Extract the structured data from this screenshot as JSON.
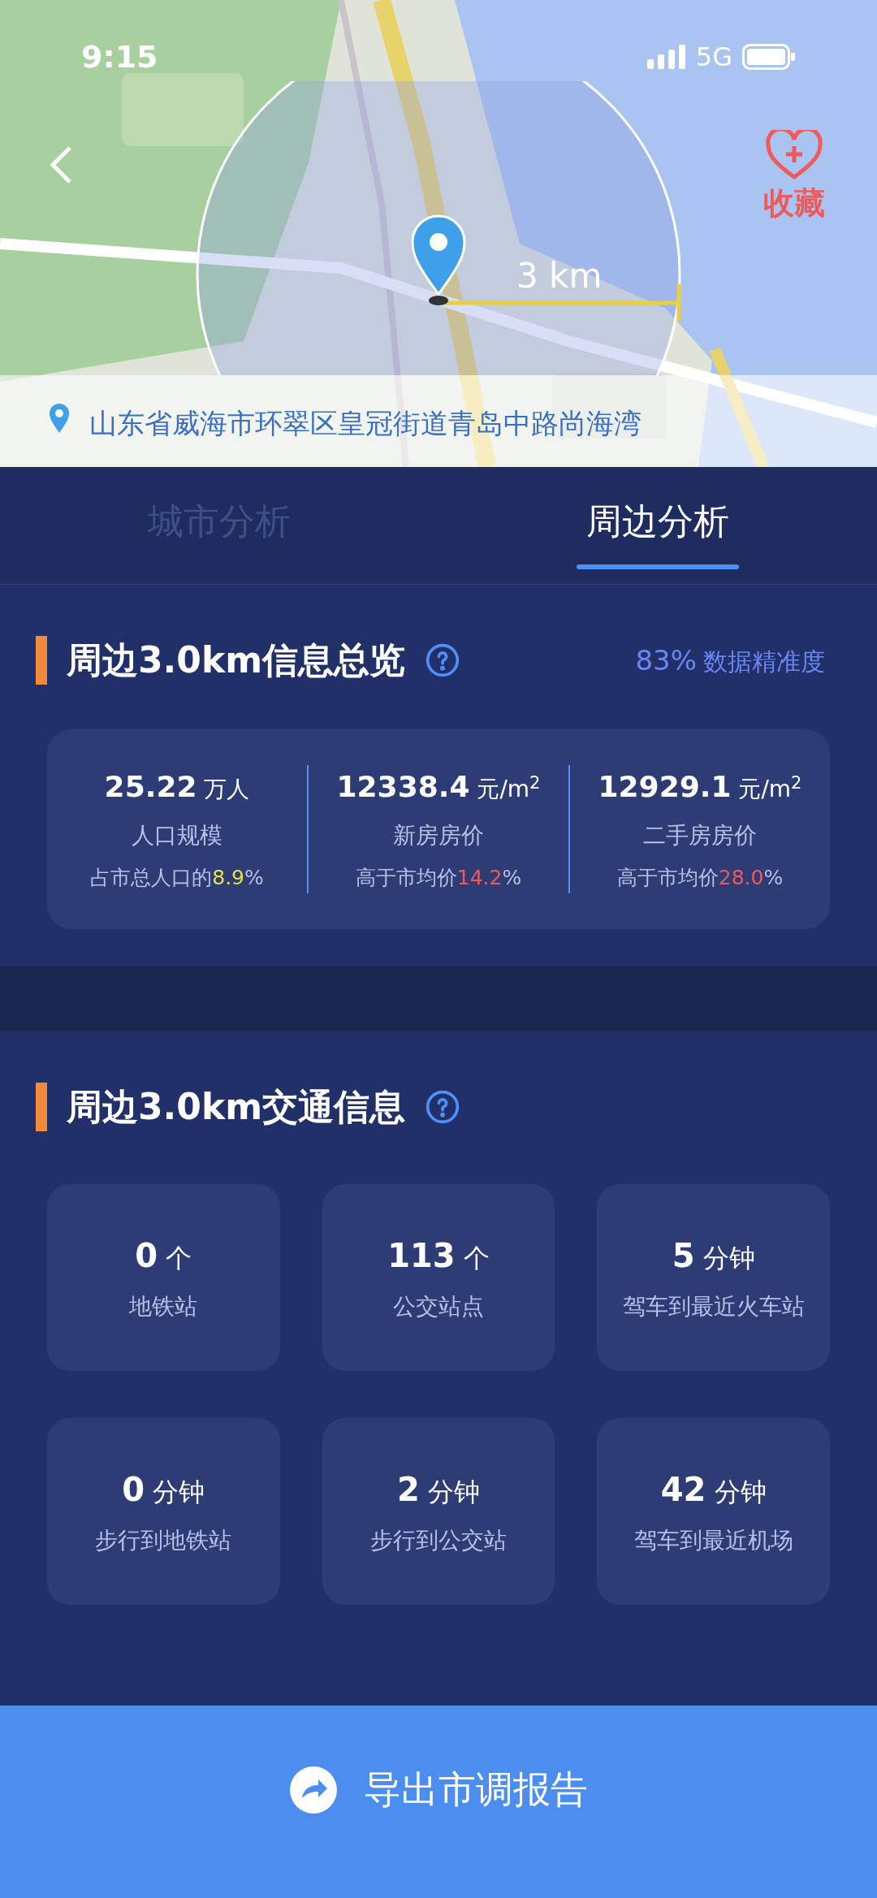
{
  "status_bar": {
    "time": "9:15",
    "network": "5G"
  },
  "map": {
    "kind": "picture",
    "radius_label": "3 km",
    "address": "山东省威海市环翠区皇冠街道青岛中路尚海湾",
    "favorite_label": "收藏"
  },
  "tabs": [
    {
      "label": "城市分析",
      "selected": false
    },
    {
      "label": "周边分析",
      "selected": true
    }
  ],
  "overview": {
    "title": "周边3.0km信息总览",
    "accuracy_value": "83%",
    "accuracy_label": "数据精准度",
    "stats": [
      {
        "value": "25.22",
        "unit": "万人",
        "label": "人口规模",
        "note_prefix": "占市总人口的",
        "note_value": "8.9",
        "note_suffix": "%",
        "color": "#e6e04a"
      },
      {
        "value": "12338.4",
        "unit": "元/m$^{2}$",
        "label": "新房房价",
        "note_prefix": "高于市均价",
        "note_value": "14.2",
        "note_suffix": "%",
        "color": "#f0585c"
      },
      {
        "value": "12929.1",
        "unit": "元/m$^{2}$",
        "label": "二手房房价",
        "note_prefix": "高于市均价",
        "note_value": "28.0",
        "note_suffix": "%",
        "color": "#f0585c"
      }
    ]
  },
  "traffic": {
    "title": "周边3.0km交通信息",
    "items": [
      {
        "value": "0",
        "unit": "个",
        "label": "地铁站"
      },
      {
        "value": "113",
        "unit": "个",
        "label": "公交站点"
      },
      {
        "value": "5",
        "unit": "分钟",
        "label": "驾车到最近火车站"
      },
      {
        "value": "0",
        "unit": "分钟",
        "label": "步行到地铁站"
      },
      {
        "value": "2",
        "unit": "分钟",
        "label": "步行到公交站"
      },
      {
        "value": "42",
        "unit": "分钟",
        "label": "驾车到最近机场"
      }
    ]
  },
  "export_button": {
    "label": "导出市调报告"
  }
}
